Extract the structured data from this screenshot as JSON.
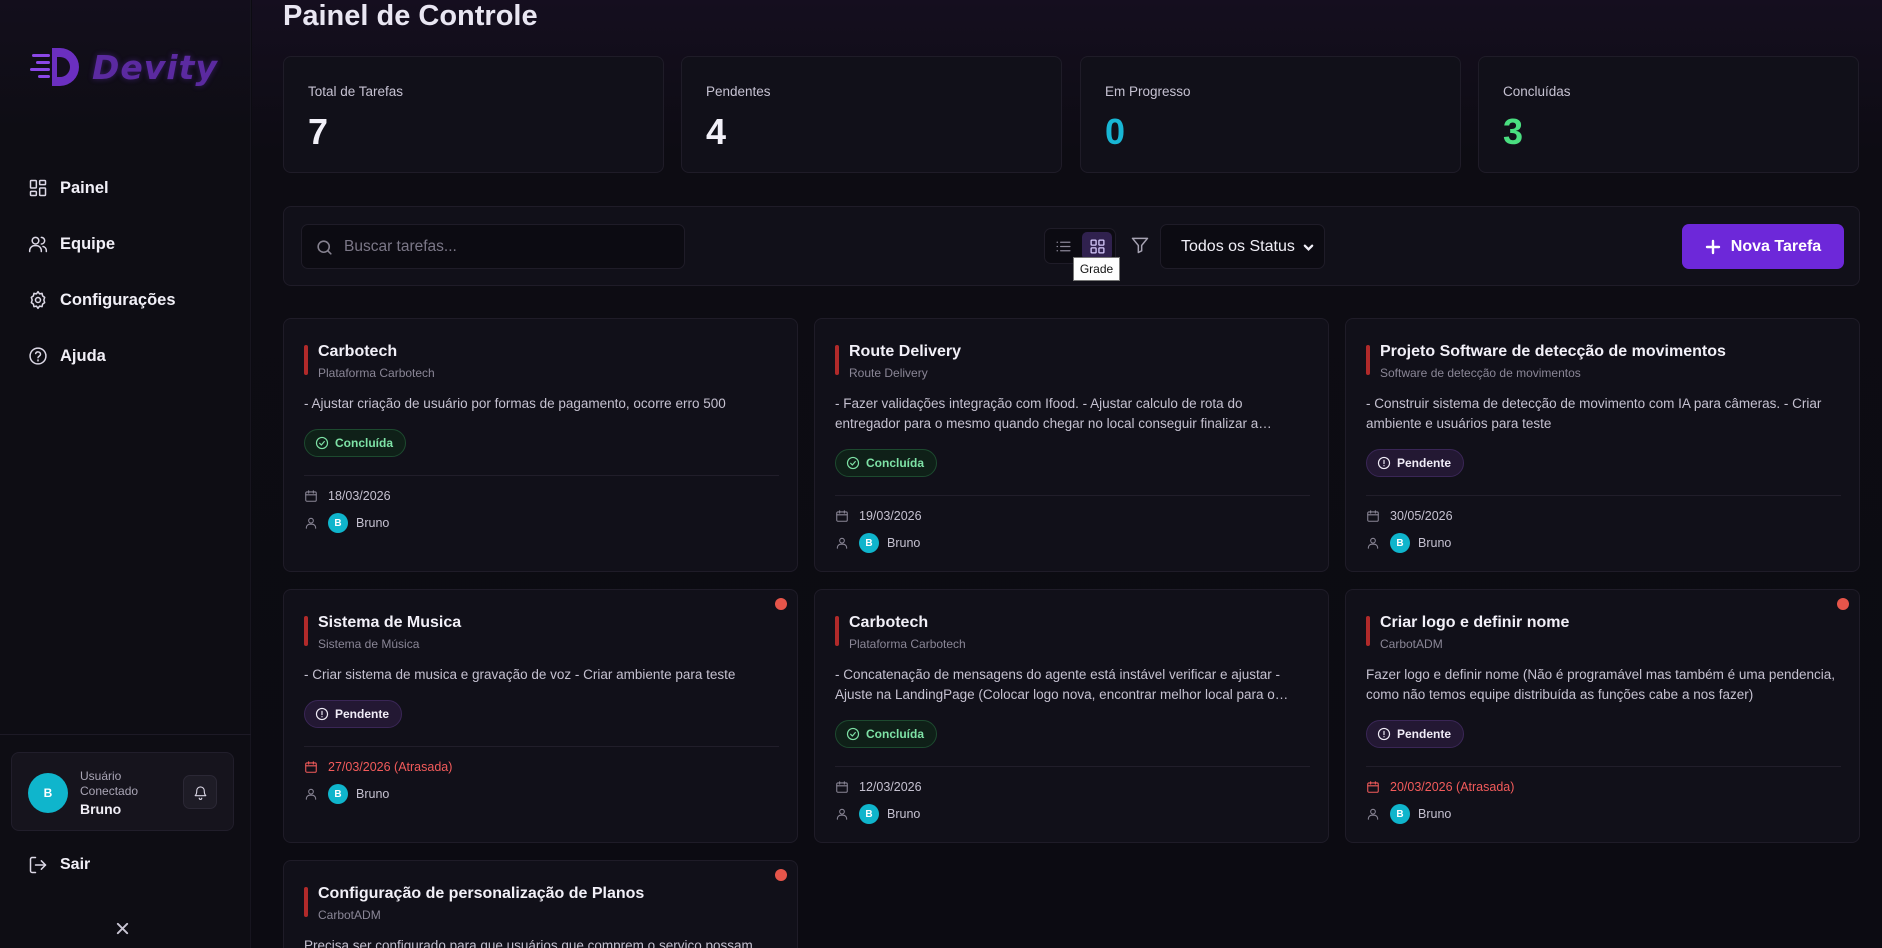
{
  "brand": {
    "name": "Devity"
  },
  "sidebar": {
    "items": [
      {
        "label": "Painel",
        "icon": "dashboard-icon"
      },
      {
        "label": "Equipe",
        "icon": "users-icon"
      },
      {
        "label": "Configurações",
        "icon": "gear-icon"
      },
      {
        "label": "Ajuda",
        "icon": "help-icon"
      }
    ],
    "user": {
      "initial": "B",
      "status": "Usuário Conectado",
      "name": "Bruno"
    },
    "logout_label": "Sair"
  },
  "page": {
    "title": "Painel de Controle"
  },
  "stats": [
    {
      "label": "Total de Tarefas",
      "value": "7",
      "color": "#f2f0f8"
    },
    {
      "label": "Pendentes",
      "value": "4",
      "color": "#f2f0f8"
    },
    {
      "label": "Em Progresso",
      "value": "0",
      "color": "#18b6d4"
    },
    {
      "label": "Concluídas",
      "value": "3",
      "color": "#4ade80"
    }
  ],
  "toolbar": {
    "search_placeholder": "Buscar tarefas...",
    "view_tooltip": "Grade",
    "status_filter": "Todos os Status",
    "new_task_label": "Nova Tarefa"
  },
  "tasks": [
    {
      "title": "Carbotech",
      "project": "Plataforma Carbotech",
      "description": "- Ajustar criação de usuário por formas de pagamento, ocorre erro 500",
      "status": "Concluída",
      "date": "18/03/2026",
      "assignee_initial": "B",
      "assignee": "Bruno"
    },
    {
      "title": "Route Delivery",
      "project": "Route Delivery",
      "description": "- Fazer validações integração com Ifood. - Ajustar calculo de rota do entregador para o mesmo quando chegar no local conseguir finalizar a entrega",
      "status": "Concluída",
      "date": "19/03/2026",
      "assignee_initial": "B",
      "assignee": "Bruno"
    },
    {
      "title": "Projeto Software de detecção de movimentos",
      "project": "Software de detecção de movimentos",
      "description": "- Construir sistema de detecção de movimento com IA para câmeras. - Criar ambiente e usuários para teste",
      "status": "Pendente",
      "date": "30/05/2026",
      "assignee_initial": "B",
      "assignee": "Bruno"
    },
    {
      "title": "Sistema de Musica",
      "project": "Sistema de Música",
      "description": "- Criar sistema de musica e gravação de voz - Criar ambiente para teste",
      "status": "Pendente",
      "date": "27/03/2026 (Atrasada)",
      "assignee_initial": "B",
      "assignee": "Bruno"
    },
    {
      "title": "Carbotech",
      "project": "Plataforma Carbotech",
      "description": "- Concatenação de mensagens do agente está instável verificar e ajustar - Ajuste na LandingPage (Colocar logo nova, encontrar melhor local para o chat)",
      "status": "Concluída",
      "date": "12/03/2026",
      "assignee_initial": "B",
      "assignee": "Bruno"
    },
    {
      "title": "Criar logo e definir nome",
      "project": "CarbotADM",
      "description": "Fazer logo e definir nome (Não é programável mas também é uma pendencia, como não temos equipe distribuída as funções cabe a nos fazer)",
      "status": "Pendente",
      "date": "20/03/2026 (Atrasada)",
      "assignee_initial": "B",
      "assignee": "Bruno"
    },
    {
      "title": "Configuração de personalização de Planos",
      "project": "CarbotADM",
      "description": "Precisa ser configurado para que usuários que comprem o serviço possam personalizar seus planos"
    }
  ]
}
